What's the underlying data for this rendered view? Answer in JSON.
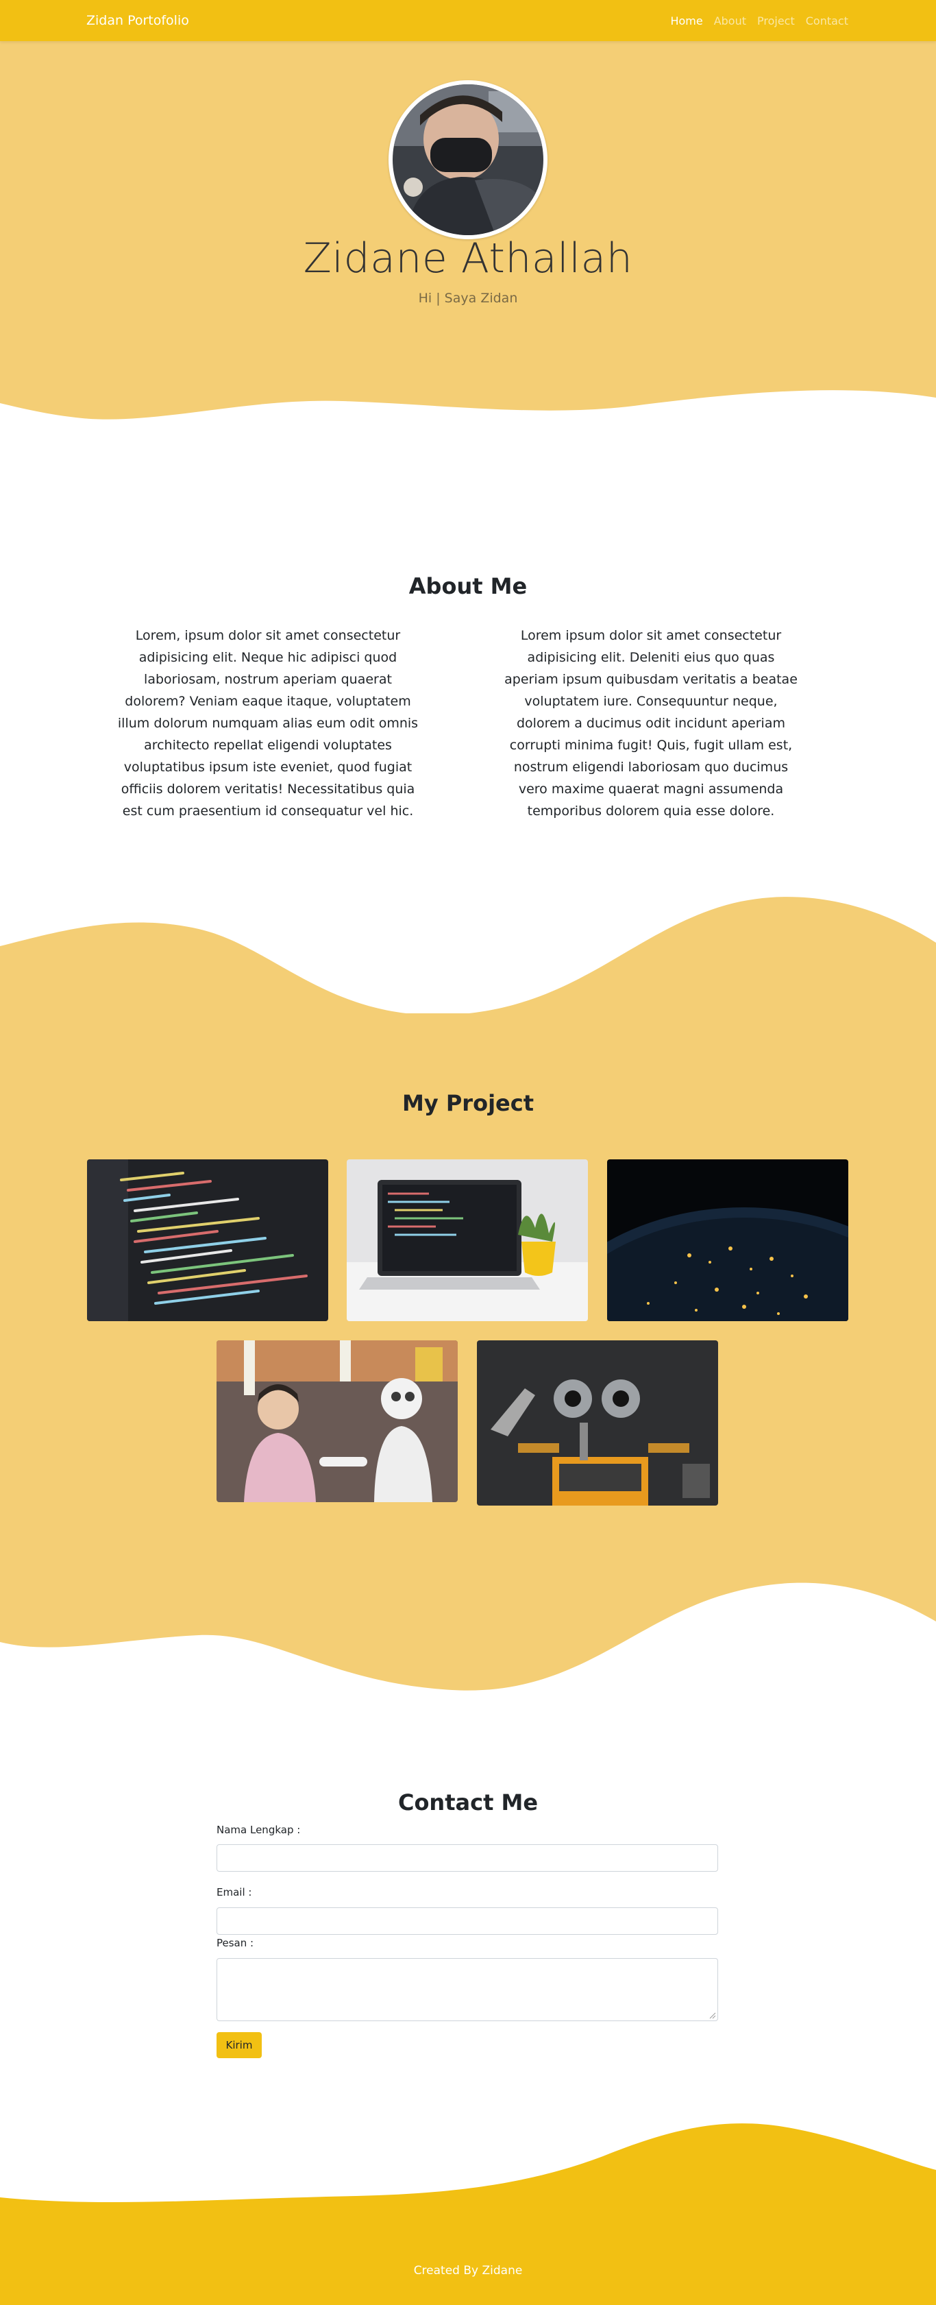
{
  "nav": {
    "brand": "Zidan Portofolio",
    "links": [
      "Home",
      "About",
      "Project",
      "Contact"
    ],
    "active": "Home"
  },
  "hero": {
    "name": "Zidane Athallah",
    "subtitle": "Hi | Saya Zidan"
  },
  "about": {
    "title": "About Me",
    "paragraphs": [
      "Lorem, ipsum dolor sit amet consectetur adipisicing elit. Neque hic adipisci quod laboriosam, nostrum aperiam quaerat dolorem? Veniam eaque itaque, voluptatem illum dolorum numquam alias eum odit omnis architecto repellat eligendi voluptates voluptatibus ipsum iste eveniet, quod fugiat officiis dolorem veritatis! Necessitatibus quia est cum praesentium id consequatur vel hic.",
      "Lorem ipsum dolor sit amet consectetur adipisicing elit. Deleniti eius quo quas aperiam ipsum quibusdam veritatis a beatae voluptatem iure. Consequuntur neque, dolorem a ducimus odit incidunt aperiam corrupti minima fugit! Quis, fugit ullam est, nostrum eligendi laboriosam quo ducimus vero maxime quaerat magni assumenda temporibus dolorem quia esse dolore."
    ]
  },
  "project": {
    "title": "My Project",
    "images": [
      "code-screen-image",
      "laptop-desk-image",
      "earth-night-image",
      "child-robot-image",
      "wall-e-robot-image"
    ]
  },
  "contact": {
    "title": "Contact Me",
    "name_label": "Nama Lengkap :",
    "email_label": "Email :",
    "message_label": "Pesan :",
    "submit_label": "Kirim"
  },
  "footer": {
    "text": "Created By Zidane"
  },
  "colors": {
    "primary": "#f2c013",
    "hero_bg": "#f4ce75",
    "white": "#ffffff"
  }
}
